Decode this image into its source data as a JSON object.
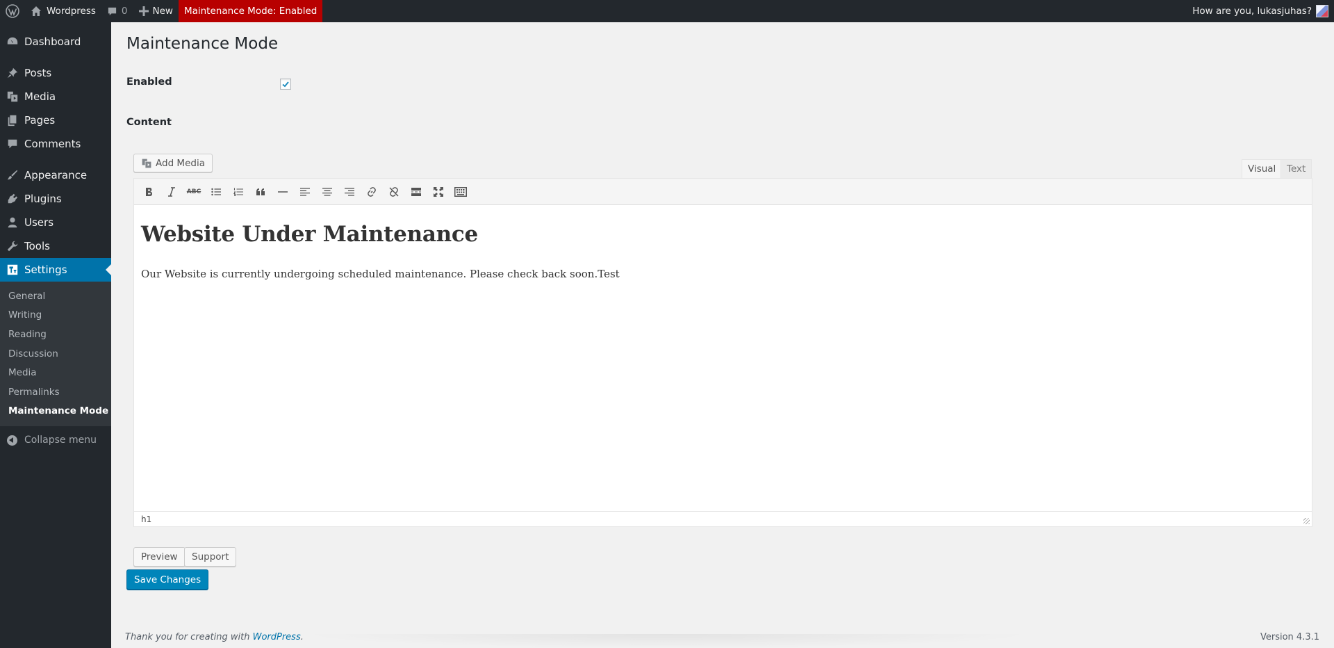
{
  "adminbar": {
    "site_name": "Wordpress",
    "comments_count": "0",
    "new_label": "New",
    "maintenance_label": "Maintenance Mode: Enabled",
    "greeting": "How are you, lukasjuhas?"
  },
  "sidebar": {
    "menu": [
      {
        "label": "Dashboard",
        "icon": "dashboard-icon"
      },
      {
        "label": "Posts",
        "icon": "pin-icon"
      },
      {
        "label": "Media",
        "icon": "media-icon"
      },
      {
        "label": "Pages",
        "icon": "pages-icon"
      },
      {
        "label": "Comments",
        "icon": "comment-icon"
      },
      {
        "label": "Appearance",
        "icon": "brush-icon"
      },
      {
        "label": "Plugins",
        "icon": "plug-icon"
      },
      {
        "label": "Users",
        "icon": "user-icon"
      },
      {
        "label": "Tools",
        "icon": "wrench-icon"
      },
      {
        "label": "Settings",
        "icon": "settings-icon"
      }
    ],
    "submenu": [
      "General",
      "Writing",
      "Reading",
      "Discussion",
      "Media",
      "Permalinks",
      "Maintenance Mode"
    ],
    "collapse_label": "Collapse menu"
  },
  "main": {
    "title": "Maintenance Mode",
    "enabled_label": "Enabled",
    "enabled_checked": true,
    "content_label": "Content",
    "add_media_label": "Add Media",
    "tab_visual": "Visual",
    "tab_text": "Text",
    "editor_heading": "Website Under Maintenance",
    "editor_paragraph": "Our Website is currently undergoing scheduled maintenance. Please check back soon.Test",
    "status_path": "h1",
    "preview_label": "Preview",
    "support_label": "Support",
    "save_label": "Save Changes"
  },
  "footer": {
    "thanks_prefix": "Thank you for creating with",
    "thanks_link": "WordPress",
    "thanks_suffix": ".",
    "version": "Version 4.3.1"
  },
  "colors": {
    "adminbar_bg": "#23282d",
    "maintenance_bg": "#b80000",
    "accent": "#0073aa",
    "primary_button": "#0085ba"
  }
}
